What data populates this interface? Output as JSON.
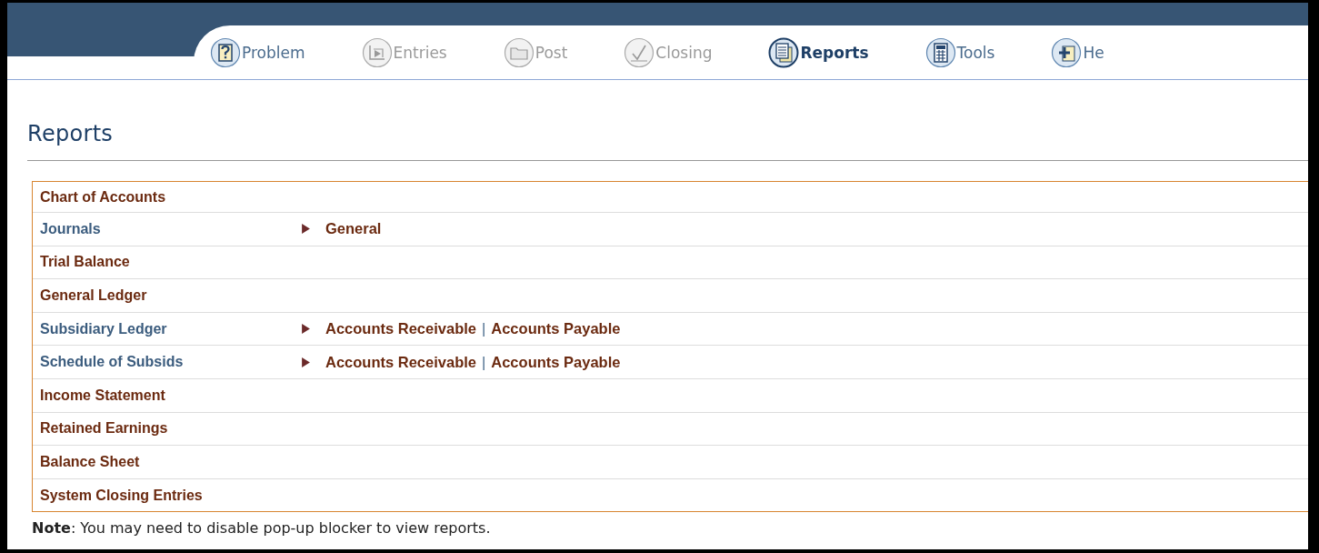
{
  "nav": [
    {
      "label": "Problem",
      "disabled": false,
      "selected": false
    },
    {
      "label": "Entries",
      "disabled": true,
      "selected": false
    },
    {
      "label": "Post",
      "disabled": true,
      "selected": false
    },
    {
      "label": "Closing",
      "disabled": true,
      "selected": false
    },
    {
      "label": "Reports",
      "disabled": false,
      "selected": true
    },
    {
      "label": "Tools",
      "disabled": false,
      "selected": false
    },
    {
      "label": "He",
      "disabled": false,
      "selected": false
    }
  ],
  "heading": "Reports",
  "reports": [
    {
      "label": "Chart of Accounts",
      "kind": "single"
    },
    {
      "label": "Journals",
      "kind": "group",
      "links": [
        "General"
      ]
    },
    {
      "label": "Trial Balance",
      "kind": "single"
    },
    {
      "label": "General Ledger",
      "kind": "single"
    },
    {
      "label": "Subsidiary Ledger",
      "kind": "group",
      "links": [
        "Accounts Receivable",
        "Accounts Payable"
      ]
    },
    {
      "label": "Schedule of Subsids",
      "kind": "group",
      "links": [
        "Accounts Receivable",
        "Accounts Payable"
      ]
    },
    {
      "label": "Income Statement",
      "kind": "single"
    },
    {
      "label": "Retained Earnings",
      "kind": "single"
    },
    {
      "label": "Balance Sheet",
      "kind": "single"
    },
    {
      "label": "System Closing Entries",
      "kind": "single"
    }
  ],
  "separator": "|",
  "note": "**Note**: You may need to disable pop-up blocker to view reports."
}
